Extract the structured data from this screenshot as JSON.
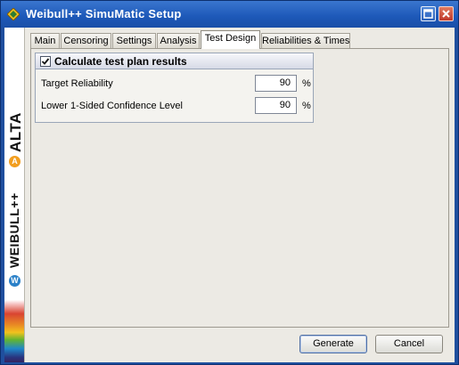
{
  "window": {
    "title": "Weibull++ SimuMatic Setup"
  },
  "branding": {
    "product_top": "ALTA",
    "product_bottom": "WEIBULL++",
    "badge_top": "A",
    "badge_bottom": "W"
  },
  "tabs": [
    {
      "label": "Main",
      "active": false
    },
    {
      "label": "Censoring",
      "active": false
    },
    {
      "label": "Settings",
      "active": false
    },
    {
      "label": "Analysis",
      "active": false
    },
    {
      "label": "Test Design",
      "active": true
    },
    {
      "label": "Reliabilities & Times",
      "active": false
    }
  ],
  "test_design": {
    "group_title": "Calculate test plan results",
    "calculate_checked": true,
    "target_reliability_label": "Target Reliability",
    "target_reliability_value": "90",
    "target_reliability_unit": "%",
    "confidence_label": "Lower 1-Sided Confidence Level",
    "confidence_value": "90",
    "confidence_unit": "%"
  },
  "footer": {
    "generate_label": "Generate",
    "cancel_label": "Cancel"
  },
  "colors": {
    "titlebar": "#1d58b8",
    "client_bg": "#eceae4",
    "group_border": "#9aa6b8"
  }
}
